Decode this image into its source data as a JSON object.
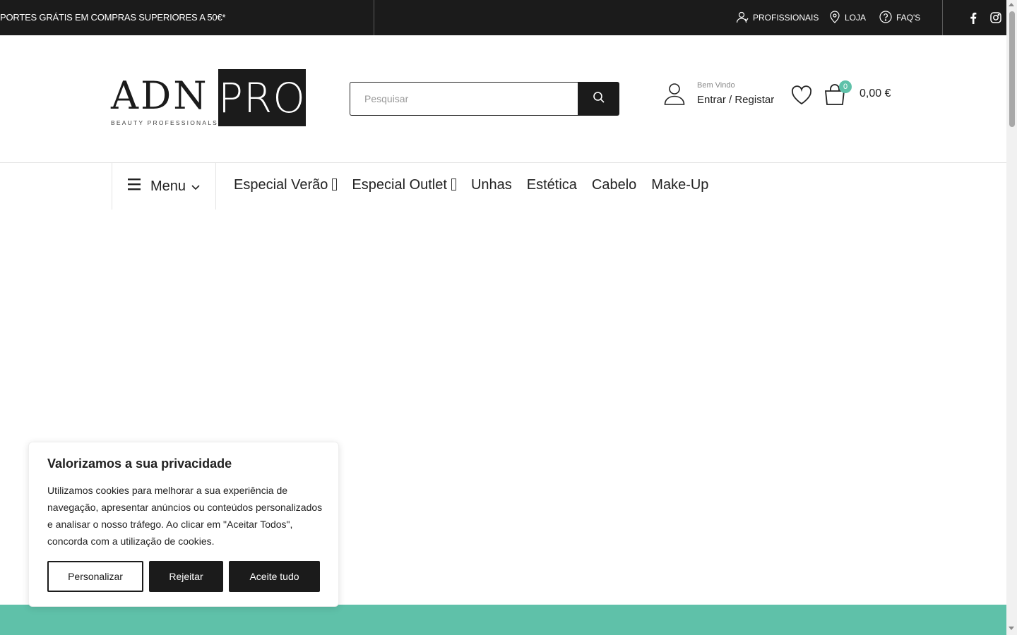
{
  "topbar": {
    "promo": "PORTES GRÁTIS EM COMPRAS SUPERIORES A 50€*",
    "links": [
      {
        "label": "PROFISSIONAIS",
        "icon": "professionals-icon"
      },
      {
        "label": "LOJA",
        "icon": "map-pin-icon"
      },
      {
        "label": "FAQ'S",
        "icon": "question-icon"
      }
    ],
    "social": [
      "facebook-icon",
      "instagram-icon"
    ]
  },
  "header": {
    "logo_main": "ADN",
    "logo_box": "PRO",
    "logo_sub": "BEAUTY PROFESSIONALS",
    "search_placeholder": "Pesquisar",
    "welcome": "Bem Vindo",
    "login": "Entrar / Registar",
    "cart_count": "0",
    "cart_total": "0,00 €"
  },
  "nav": {
    "menu_label": "Menu",
    "items": [
      "Especial Verão",
      "Especial Outlet",
      "Unhas",
      "Estética",
      "Cabelo",
      "Make-Up"
    ]
  },
  "cookie": {
    "title": "Valorizamos a sua privacidade",
    "text": "Utilizamos cookies para melhorar a sua experiência de navegação, apresentar anúncios ou conteúdos personalizados e analisar o nosso tráfego. Ao clicar em \"Aceitar Todos\", concorda com a utilização de cookies.",
    "customize": "Personalizar",
    "reject": "Rejeitar",
    "accept": "Aceite tudo"
  },
  "colors": {
    "dark": "#1b1b1b",
    "accent": "#5fc1a9"
  }
}
